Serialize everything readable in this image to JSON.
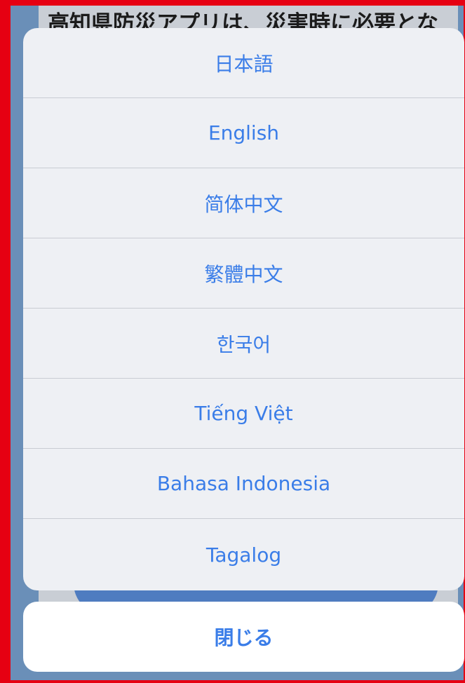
{
  "background": {
    "banner_text": "高知県防災アプリは、災害時に必要とな"
  },
  "language_sheet": {
    "options": [
      {
        "label": "日本語"
      },
      {
        "label": "English"
      },
      {
        "label": "简体中文"
      },
      {
        "label": "繁體中文"
      },
      {
        "label": "한국어"
      },
      {
        "label": "Tiếng Việt"
      },
      {
        "label": "Bahasa Indonesia"
      },
      {
        "label": "Tagalog"
      }
    ]
  },
  "close_button": {
    "label": "閉じる"
  },
  "colors": {
    "accent": "#3a7de8",
    "frame": "#e60012",
    "sheet_bg": "#eef0f4",
    "separator": "#c9ccd3"
  }
}
